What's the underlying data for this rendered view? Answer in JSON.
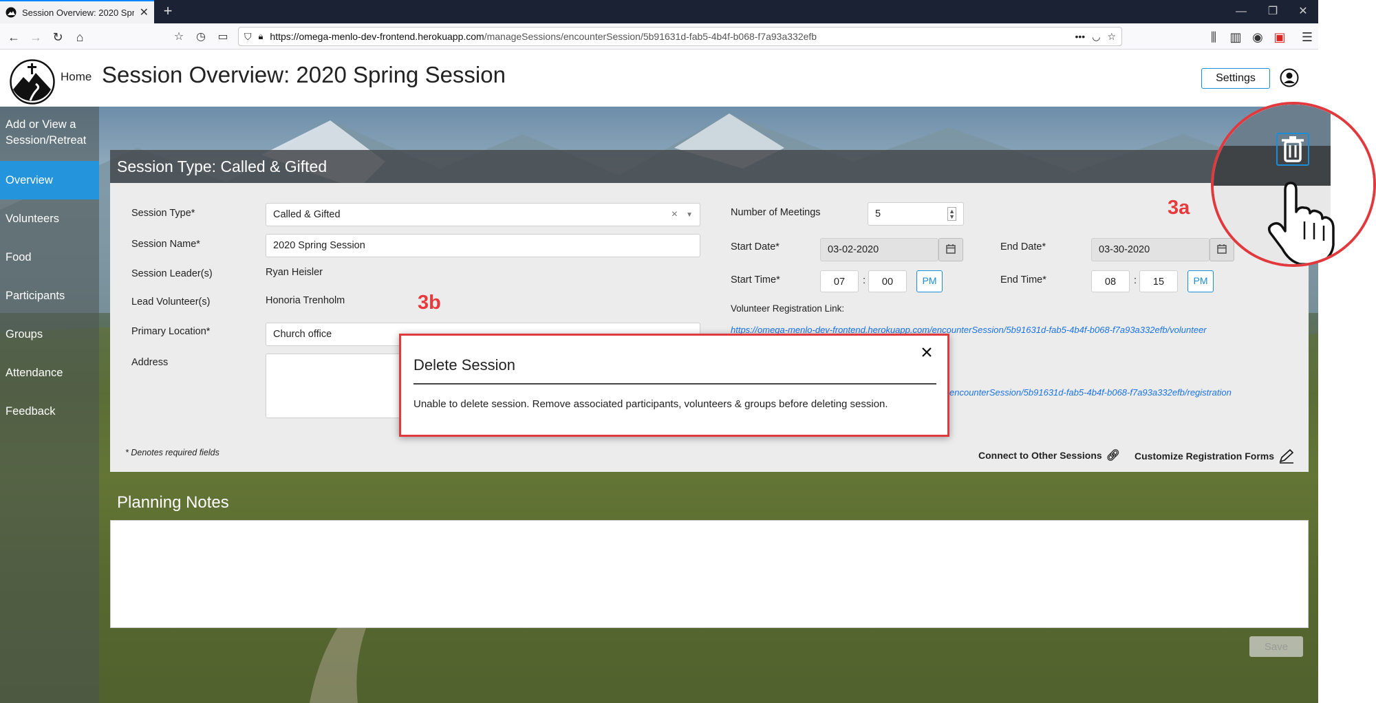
{
  "browser": {
    "tab_title": "Session Overview: 2020 Spring Session",
    "url_host": "https://omega-menlo-dev-frontend.herokuapp.com",
    "url_path": "/manageSessions/encounterSession/5b91631d-fab5-4b4f-b068-f7a93a332efb",
    "menu_dots": "•••"
  },
  "header": {
    "home_label": "Home",
    "page_title": "Session Overview: 2020 Spring Session",
    "settings_label": "Settings"
  },
  "sidebar": {
    "items": [
      {
        "label_line1": "Add or View a",
        "label_line2": "Session/Retreat"
      },
      {
        "label": "Overview"
      },
      {
        "label": "Volunteers"
      },
      {
        "label": "Food"
      },
      {
        "label": "Participants"
      },
      {
        "label": "Groups"
      },
      {
        "label": "Attendance"
      },
      {
        "label": "Feedback"
      }
    ],
    "active_index": 1
  },
  "session": {
    "card_title": "Session Type: Called & Gifted",
    "labels": {
      "session_type": "Session Type*",
      "session_name": "Session Name*",
      "session_leaders": "Session Leader(s)",
      "lead_volunteers": "Lead Volunteer(s)",
      "primary_location": "Primary Location*",
      "address": "Address",
      "number_of_meetings": "Number of Meetings",
      "start_date": "Start Date*",
      "end_date": "End Date*",
      "start_time": "Start Time*",
      "end_time": "End Time*",
      "volunteer_link": "Volunteer Registration Link:"
    },
    "values": {
      "session_type": "Called & Gifted",
      "session_type_clear": "×",
      "session_name": "2020 Spring Session",
      "session_leaders": "Ryan Heisler",
      "lead_volunteers": "Honoria Trenholm",
      "primary_location": "Church office",
      "number_of_meetings": "5",
      "start_date": "03-02-2020",
      "end_date": "03-30-2020",
      "start_hour": "07",
      "start_minute": "00",
      "start_ampm": "PM",
      "end_hour": "08",
      "end_minute": "15",
      "end_ampm": "PM",
      "time_sep": ":"
    },
    "volunteer_link_url": "https://omega-menlo-dev-frontend.herokuapp.com/encounterSession/5b91631d-fab5-4b4f-b068-f7a93a332efb/volunteer",
    "registration_link_url_visible": "encounterSession/5b91631d-fab5-4b4f-b068-f7a93a332efb/registration",
    "required_note": "* Denotes required fields",
    "connect_label": "Connect to Other Sessions",
    "customize_label": "Customize Registration Forms"
  },
  "notes": {
    "title": "Planning Notes",
    "save_label": "Save"
  },
  "modal": {
    "title": "Delete Session",
    "message": "Unable to delete session. Remove associated participants, volunteers & groups before deleting session."
  },
  "annotations": {
    "label_a": "3a",
    "label_b": "3b",
    "accent": "#e8393d"
  },
  "colors": {
    "primary": "#2495dc",
    "link": "#1a73e8"
  }
}
